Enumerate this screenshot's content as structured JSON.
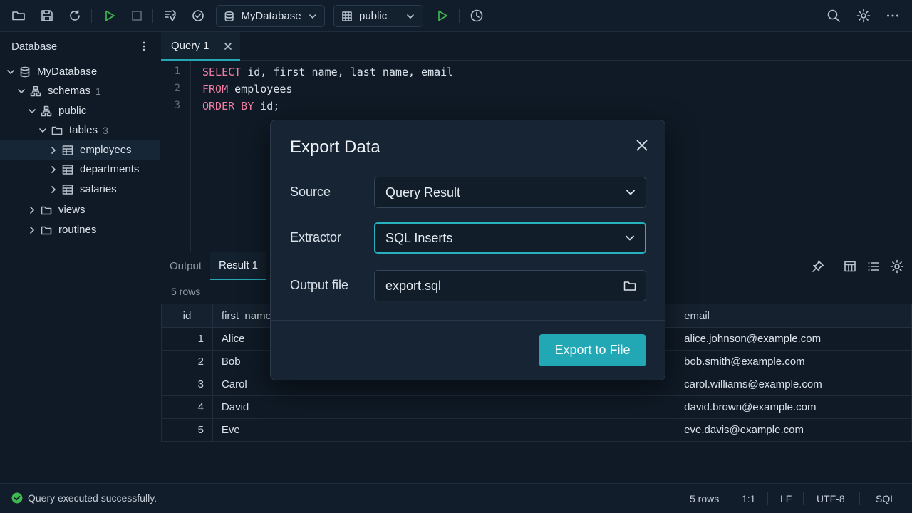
{
  "toolbar": {
    "database_selector": {
      "value": "MyDatabase"
    },
    "schema_selector": {
      "value": "public"
    },
    "icons": [
      "folder-open-icon",
      "save-icon",
      "refresh-icon",
      "run-icon",
      "stop-icon",
      "transaction-icon",
      "commit-icon",
      "run-script-icon",
      "history-icon",
      "search-icon",
      "settings-icon",
      "more-icon"
    ]
  },
  "sidebar": {
    "title": "Database",
    "tree": {
      "database": {
        "label": "MyDatabase"
      },
      "schemas": {
        "label": "schemas",
        "count": "1"
      },
      "public": {
        "label": "public"
      },
      "tables": {
        "label": "tables",
        "count": "3"
      },
      "employees": {
        "label": "employees"
      },
      "departments": {
        "label": "departments"
      },
      "salaries": {
        "label": "salaries"
      },
      "views": {
        "label": "views"
      },
      "routines": {
        "label": "routines"
      }
    }
  },
  "editor": {
    "tab_label": "Query 1",
    "lines": [
      {
        "num": "1",
        "kw": "SELECT",
        "rest": " id, first_name, last_name, email"
      },
      {
        "num": "2",
        "kw": "FROM",
        "rest": " employees"
      },
      {
        "num": "3",
        "kw": "ORDER BY",
        "rest": " id;"
      }
    ]
  },
  "results": {
    "tabs": {
      "output": "Output",
      "result": "Result 1"
    },
    "row_count": "5 rows",
    "columns": {
      "id": "id",
      "first_name": "first_name",
      "email": "email"
    },
    "rows": [
      {
        "id": "1",
        "first_name": "Alice",
        "email": "alice.johnson@example.com"
      },
      {
        "id": "2",
        "first_name": "Bob",
        "email": "bob.smith@example.com"
      },
      {
        "id": "3",
        "first_name": "Carol",
        "email": "carol.williams@example.com"
      },
      {
        "id": "4",
        "first_name": "David",
        "email": "david.brown@example.com"
      },
      {
        "id": "5",
        "first_name": "Eve",
        "email": "eve.davis@example.com"
      }
    ]
  },
  "modal": {
    "title": "Export Data",
    "source": {
      "label": "Source",
      "value": "Query Result"
    },
    "extractor": {
      "label": "Extractor",
      "value": "SQL Inserts"
    },
    "output_file": {
      "label": "Output file",
      "value": "export.sql"
    },
    "export_button": "Export to File"
  },
  "statusbar": {
    "message": "Query executed successfully.",
    "rows": "5 rows",
    "position": "1:1",
    "line_ending": "LF",
    "encoding": "UTF-8",
    "language": "SQL"
  },
  "colors": {
    "accent": "#26a7b4",
    "success": "#3fb950",
    "keyword": "#f07fa3"
  }
}
